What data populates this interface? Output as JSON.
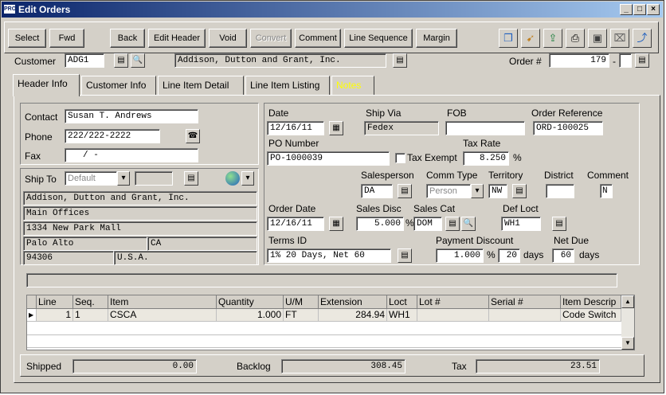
{
  "window": {
    "title": "Edit Orders",
    "app_badge": "PRO"
  },
  "toolbar": {
    "select": "Select",
    "fwd": "Fwd",
    "back": "Back",
    "edit_header": "Edit Header",
    "void": "Void",
    "convert": "Convert",
    "comment": "Comment",
    "line_sequence": "Line Sequence",
    "margin": "Margin"
  },
  "customer": {
    "label": "Customer",
    "code": "ADG1",
    "name": "Addison, Dutton and Grant, Inc."
  },
  "order": {
    "label": "Order #",
    "number": "179",
    "dash": "-"
  },
  "tabs": [
    "Header Info",
    "Customer Info",
    "Line Item Detail",
    "Line Item Listing",
    "Notes"
  ],
  "contact": {
    "contact_label": "Contact",
    "contact": "Susan T. Andrews",
    "phone_label": "Phone",
    "phone": "222/222-2222",
    "fax_label": "Fax",
    "fax": "/  -"
  },
  "ship_to": {
    "label": "Ship To",
    "selection": "Default",
    "addr1": "Addison, Dutton and Grant, Inc.",
    "addr2": "Main Offices",
    "addr3": "1334 New Park Mall",
    "city": "Palo Alto",
    "state": "CA",
    "zip": "94306",
    "country": "U.S.A."
  },
  "header": {
    "date_label": "Date",
    "date": "12/16/11",
    "ship_via_label": "Ship Via",
    "ship_via": "Fedex",
    "fob_label": "FOB",
    "fob": "",
    "order_ref_label": "Order Reference",
    "order_ref": "ORD-100025",
    "po_label": "PO Number",
    "po": "PO-1000039",
    "tax_exempt_label": "Tax Exempt",
    "tax_rate_label": "Tax Rate",
    "tax_rate": "8.250",
    "pct": "%",
    "salesperson_label": "Salesperson",
    "salesperson": "DA",
    "comm_type_label": "Comm Type",
    "comm_type": "Person",
    "territory_label": "Territory",
    "territory": "NW",
    "district_label": "District",
    "district": "",
    "comment_label": "Comment",
    "comment": "N",
    "order_date_label": "Order Date",
    "order_date": "12/16/11",
    "sales_disc_label": "Sales Disc",
    "sales_disc": "5.000",
    "sales_cat_label": "Sales Cat",
    "sales_cat": "DOM",
    "def_loct_label": "Def Loct",
    "def_loct": "WH1",
    "terms_label": "Terms ID",
    "terms": "1% 20 Days, Net 60",
    "pay_disc_label": "Payment Discount",
    "pay_disc": "1.000",
    "pay_days": "20",
    "days": "days",
    "net_due_label": "Net Due",
    "net_due": "60"
  },
  "grid": {
    "columns": [
      "Line",
      "Seq.",
      "Item",
      "Quantity",
      "U/M",
      "Extension",
      "Loct",
      "Lot #",
      "Serial #",
      "Item Descrip"
    ],
    "rows": [
      [
        "1",
        "1",
        "CSCA",
        "1.000",
        "FT",
        "284.94",
        "WH1",
        "",
        "",
        "Code Switch"
      ]
    ]
  },
  "totals": {
    "shipped_label": "Shipped",
    "shipped": "0.00",
    "backlog_label": "Backlog",
    "backlog": "308.45",
    "tax_label": "Tax",
    "tax": "23.51"
  }
}
